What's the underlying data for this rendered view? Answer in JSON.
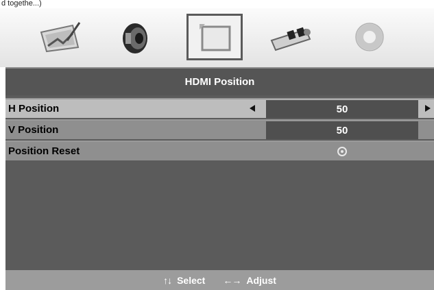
{
  "caption": "d togethe...)",
  "tabs": [
    {
      "icon": "picture-icon",
      "selected": false
    },
    {
      "icon": "speaker-icon",
      "selected": false
    },
    {
      "icon": "screen-position-icon",
      "selected": true
    },
    {
      "icon": "connector-icon",
      "selected": false
    },
    {
      "icon": "disc-icon",
      "selected": false
    }
  ],
  "menu": {
    "title": "HDMI Position",
    "rows": [
      {
        "label": "H Position",
        "value": "50"
      },
      {
        "label": "V Position",
        "value": "50"
      },
      {
        "label": "Position Reset",
        "value_icon": "reset-icon"
      }
    ]
  },
  "footer": {
    "select_keys": "↑↓",
    "select_label": "Select",
    "adjust_keys": "←→",
    "adjust_label": "Adjust"
  },
  "colors": {
    "panel": "#5b5b5b",
    "selected_row": "#bdbdbd",
    "row": "#8f8f8f",
    "value_box": "#4f4f4f",
    "footer": "#9c9c9c"
  }
}
